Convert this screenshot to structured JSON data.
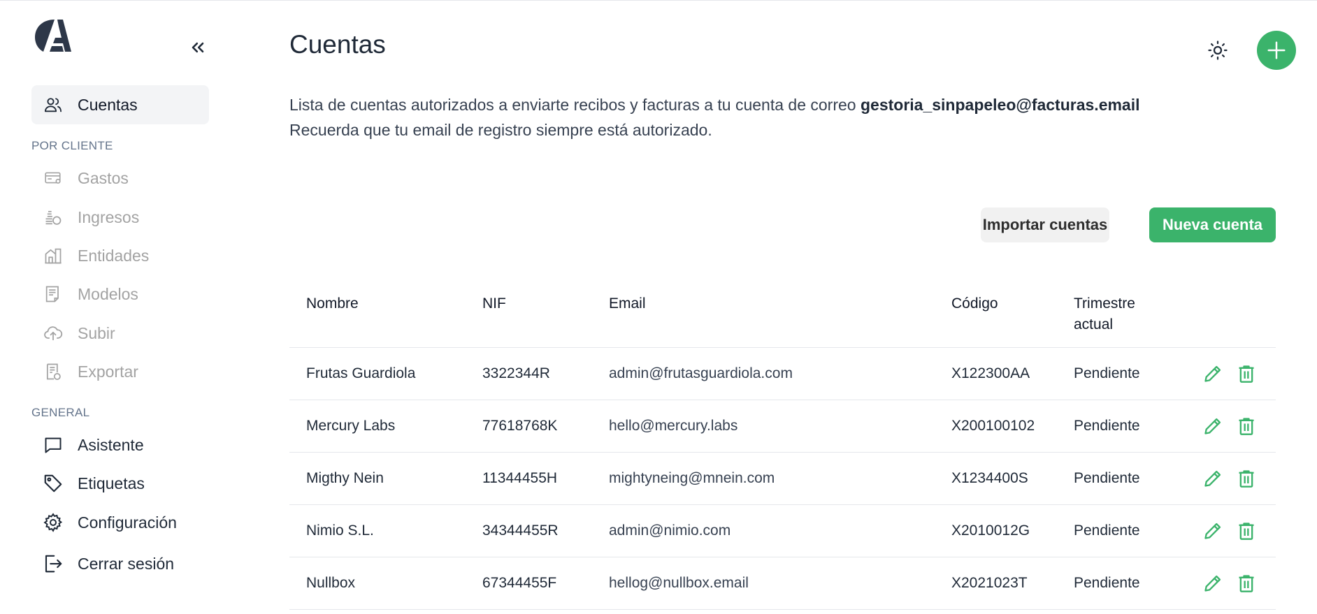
{
  "sidebar": {
    "collapse_icon": "chevrons-left-icon",
    "active_item": {
      "label": "Cuentas",
      "icon": "users-icon"
    },
    "section_client": "POR CLIENTE",
    "client_items": [
      {
        "label": "Gastos",
        "icon": "credit-card-icon"
      },
      {
        "label": "Ingresos",
        "icon": "coins-icon"
      },
      {
        "label": "Entidades",
        "icon": "building-icon"
      },
      {
        "label": "Modelos",
        "icon": "document-icon"
      },
      {
        "label": "Subir",
        "icon": "cloud-upload-icon"
      },
      {
        "label": "Exportar",
        "icon": "export-file-icon"
      }
    ],
    "section_general": "GENERAL",
    "general_items": [
      {
        "label": "Asistente",
        "icon": "chat-icon"
      },
      {
        "label": "Etiquetas",
        "icon": "tag-icon"
      },
      {
        "label": "Configuración",
        "icon": "gear-icon"
      },
      {
        "label": "Cerrar sesión",
        "icon": "logout-icon"
      }
    ]
  },
  "header": {
    "title": "Cuentas",
    "theme_icon": "sun-icon",
    "add_icon": "plus-icon"
  },
  "description": {
    "line1_prefix": "Lista de cuentas autorizados a enviarte recibos y facturas a tu cuenta de correo ",
    "email": "gestoria_sinpapeleo@facturas.email",
    "line2": "Recuerda que tu email de registro siempre está autorizado."
  },
  "actions": {
    "import_label": "Importar cuentas",
    "new_label": "Nueva cuenta"
  },
  "table": {
    "columns": [
      "Nombre",
      "NIF",
      "Email",
      "Código",
      "Trimestre actual"
    ],
    "rows": [
      {
        "nombre": "Frutas Guardiola",
        "nif": "3322344R",
        "email": "admin@frutasguardiola.com",
        "codigo": "X122300AA",
        "trimestre": "Pendiente"
      },
      {
        "nombre": "Mercury Labs",
        "nif": "77618768K",
        "email": "hello@mercury.labs",
        "codigo": "X200100102",
        "trimestre": "Pendiente"
      },
      {
        "nombre": "Migthy Nein",
        "nif": "11344455H",
        "email": "mightyneing@mnein.com",
        "codigo": "X1234400S",
        "trimestre": "Pendiente"
      },
      {
        "nombre": "Nimio S.L.",
        "nif": "34344455R",
        "email": "admin@nimio.com",
        "codigo": "X2010012G",
        "trimestre": "Pendiente"
      },
      {
        "nombre": "Nullbox",
        "nif": "67344455F",
        "email": "hellog@nullbox.email",
        "codigo": "X2021023T",
        "trimestre": "Pendiente"
      }
    ],
    "edit_icon": "pencil-icon",
    "delete_icon": "trash-icon"
  },
  "colors": {
    "accent": "#3bb36b",
    "muted_nav": "#a3a3a3",
    "section_label": "#64748b"
  }
}
